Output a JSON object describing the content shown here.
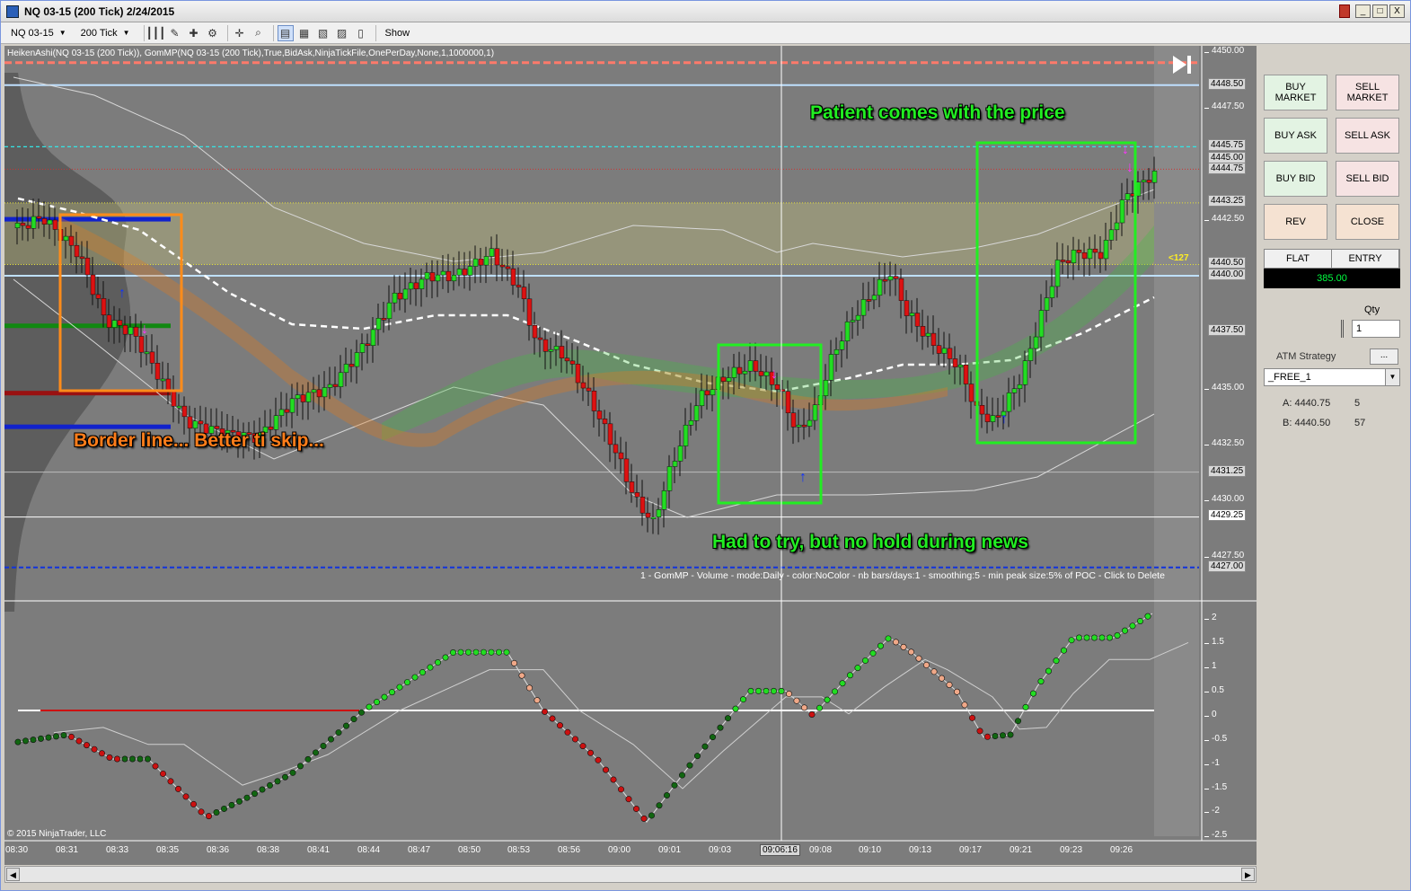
{
  "window": {
    "title": "NQ 03-15 (200 Tick)  2/24/2015",
    "controls": {
      "minimize": "_",
      "maximize": "□",
      "close": "X"
    }
  },
  "toolbar": {
    "instrument": "NQ 03-15",
    "interval": "200 Tick",
    "show_label": "Show",
    "icons": [
      "bar-type-icon",
      "pencil-icon",
      "add-indicator-icon",
      "strategy-icon",
      "crosshair-icon",
      "zoom-icon",
      "chart-trader-icon",
      "data-box-icon",
      "properties-icon",
      "print-icon",
      "template-icon"
    ]
  },
  "chart": {
    "indicator_label": "HeikenAshi(NQ 03-15 (200 Tick)), GomMP(NQ 03-15 (200 Tick),True,BidAsk,NinjaTickFile,OnePerDay,None,1,1000000,1)",
    "gom_label": "1 - GomMP - Volume - mode:Daily - color:NoColor - nb bars/days:1 - smoothing:5 - min peak size:5% of POC - Click to Delete",
    "copyright": "© 2015 NinjaTrader, LLC",
    "annotations": {
      "patient": "Patient comes with the price",
      "border": "Border line... Better ti skip...",
      "news": "Had to try, but no hold during news"
    },
    "side_marker": "<127",
    "price_ticks": [
      "4450.00",
      "4447.50",
      "4442.50",
      "4437.50",
      "4435.00",
      "4432.50",
      "4430.00",
      "4427.50"
    ],
    "price_boxes": [
      "4448.50",
      "4445.75",
      "4445.00",
      "4444.75",
      "4443.25",
      "4440.50",
      "4440.00",
      "4431.25",
      "4429.25",
      "4427.00"
    ],
    "osc_ticks": [
      "2",
      "1.5",
      "1",
      "0.5",
      "0",
      "-0.5",
      "-1",
      "-1.5",
      "-2",
      "-2.5"
    ],
    "time_labels": [
      "08:30",
      "08:31",
      "08:33",
      "08:35",
      "08:36",
      "08:38",
      "08:41",
      "08:44",
      "08:47",
      "08:50",
      "08:53",
      "08:56",
      "09:00",
      "09:01",
      "09:03",
      "09:08",
      "09:10",
      "09:13",
      "09:17",
      "09:21",
      "09:23",
      "09:26"
    ],
    "crosshair_time": "09:06:16"
  },
  "chart_data": {
    "type": "candlestick",
    "title": "NQ 03-15 (200 Tick)  2/24/2015",
    "x_range": [
      "08:30",
      "09:27"
    ],
    "y_range": [
      4425.75,
      4450.25
    ],
    "key_levels": {
      "high": 4445.75,
      "last": 4444.75,
      "crosshair_price": 4429.25,
      "low_line": 4427.0
    },
    "oscillator": {
      "range": [
        -2.5,
        2.25
      ],
      "last": 2.0
    }
  },
  "panel": {
    "buy_market": "BUY\nMARKET",
    "sell_market": "SELL\nMARKET",
    "buy_ask": "BUY ASK",
    "sell_ask": "SELL ASK",
    "buy_bid": "BUY BID",
    "sell_bid": "SELL BID",
    "rev": "REV",
    "close": "CLOSE",
    "position": {
      "flat": "FLAT",
      "entry": "ENTRY",
      "value": "385.00"
    },
    "qty_label": "Qty",
    "qty_value": "1",
    "atm_label": "ATM Strategy",
    "atm_more": "...",
    "atm_value": "_FREE_1",
    "ask_label": "A: 4440.75",
    "ask_size": "5",
    "bid_label": "B: 4440.50",
    "bid_size": "57"
  },
  "colors": {
    "up": "#22dd22",
    "down": "#dd1111",
    "box_green": "#22ee22",
    "box_orange": "#ff8c1a",
    "background": "#7c7c7c"
  }
}
